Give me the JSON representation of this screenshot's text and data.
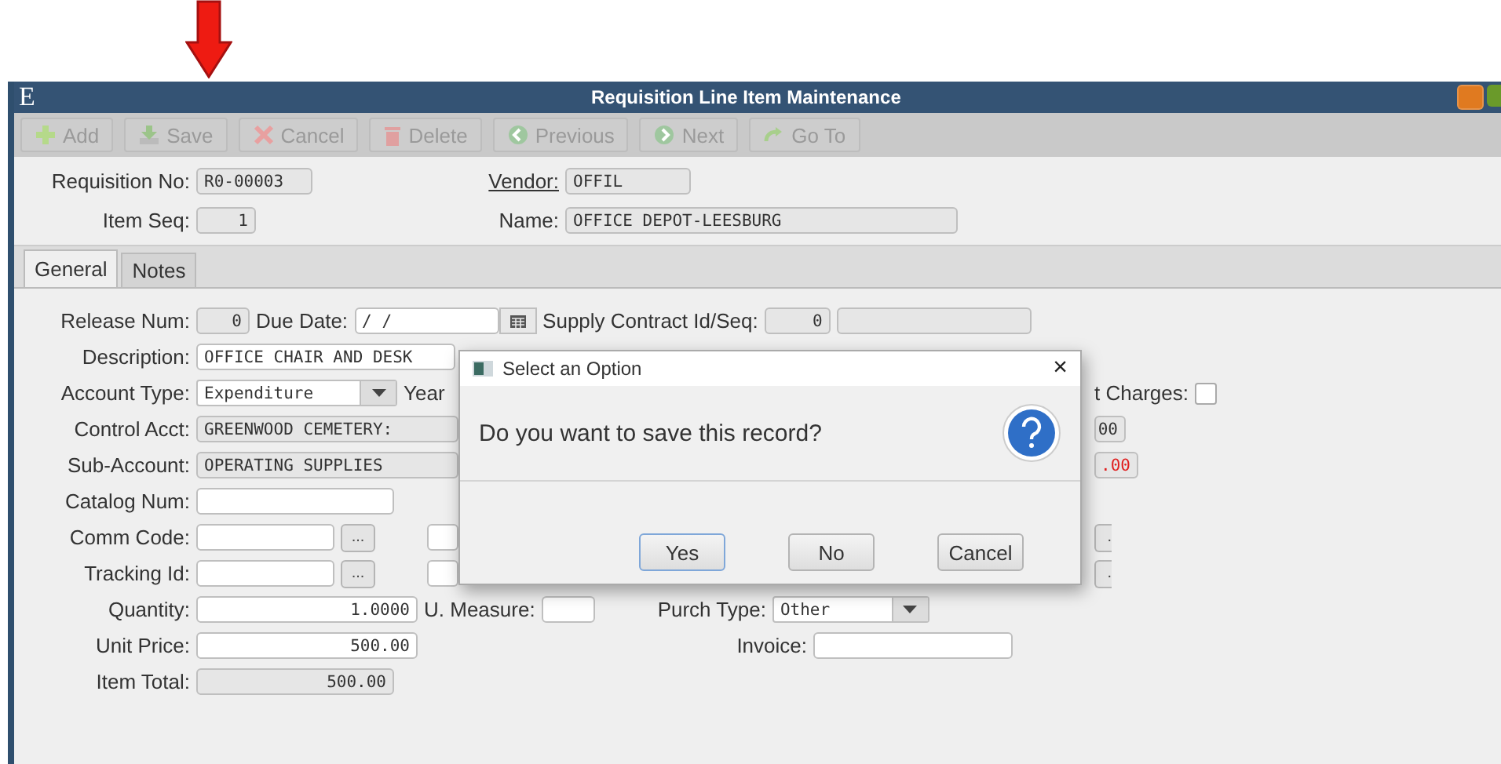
{
  "window": {
    "logo": "E",
    "title": "Requisition Line Item Maintenance"
  },
  "toolbar": [
    {
      "kind": "add",
      "label": "Add",
      "disabled": true
    },
    {
      "kind": "save",
      "label": "Save",
      "disabled": true
    },
    {
      "kind": "cancel",
      "label": "Cancel",
      "disabled": true
    },
    {
      "kind": "delete",
      "label": "Delete",
      "disabled": true
    },
    {
      "kind": "previous",
      "label": "Previous",
      "disabled": true
    },
    {
      "kind": "next",
      "label": "Next",
      "disabled": true
    },
    {
      "kind": "goto",
      "label": "Go To",
      "disabled": true
    }
  ],
  "header": {
    "requisition_no": {
      "label": "Requisition No:",
      "value": "R0-00003"
    },
    "vendor": {
      "label": "Vendor:",
      "value": "OFFIL"
    },
    "item_seq": {
      "label": "Item Seq:",
      "value": "1"
    },
    "name": {
      "label": "Name:",
      "value": "OFFICE DEPOT-LEESBURG"
    }
  },
  "tabs": [
    {
      "label": "General",
      "selected": true
    },
    {
      "label": "Notes",
      "selected": false
    }
  ],
  "general": {
    "release_num": {
      "label": "Release Num:",
      "value": "0"
    },
    "due_date": {
      "label": "Due Date:",
      "value": "/  /"
    },
    "supply_contract": {
      "label": "Supply Contract Id/Seq:",
      "value": "0"
    },
    "description": {
      "label": "Description:",
      "value": "OFFICE CHAIR AND DESK"
    },
    "account_type": {
      "label": "Account Type:",
      "value": "Expenditure"
    },
    "year_label": "Year",
    "charges": {
      "label": "t Charges:",
      "checked": false
    },
    "control_acct": {
      "label": "Control Acct:",
      "value": "GREENWOOD CEMETERY:"
    },
    "control_amount": {
      "value": "00",
      "negative": false
    },
    "sub_account": {
      "label": "Sub-Account:",
      "value": "OPERATING SUPPLIES"
    },
    "sub_amount": {
      "value": ".00",
      "negative": true
    },
    "catalog_num": {
      "label": "Catalog Num:"
    },
    "comm_code": {
      "label": "Comm Code:",
      "lookup": "...",
      "right_lookup": "."
    },
    "tracking_id": {
      "label": "Tracking Id:",
      "lookup": "...",
      "right_lookup": "."
    },
    "quantity": {
      "label": "Quantity:",
      "value": "1.0000"
    },
    "u_measure": {
      "label": "U. Measure:"
    },
    "purch_type": {
      "label": "Purch Type:",
      "value": "Other"
    },
    "unit_price": {
      "label": "Unit Price:",
      "value": "500.00"
    },
    "invoice": {
      "label": "Invoice:"
    },
    "item_total": {
      "label": "Item Total:",
      "value": "500.00"
    }
  },
  "dialog": {
    "title": "Select an Option",
    "close": "×",
    "message": "Do you want to save this record?",
    "buttons": [
      {
        "label": "Yes",
        "focused": true
      },
      {
        "label": "No",
        "focused": false
      },
      {
        "label": "Cancel",
        "focused": false
      }
    ]
  }
}
